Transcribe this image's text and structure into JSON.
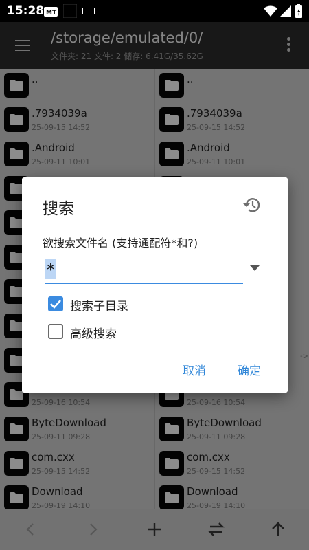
{
  "status_bar": {
    "time": "15:28",
    "icons": [
      "mt-manager-icon",
      "black-square-icon",
      "keyboard-icon",
      "wifi-icon",
      "signal-icon",
      "battery-icon"
    ]
  },
  "app_bar": {
    "path": "/storage/emulated/0/",
    "stats": "文件夹: 21  文件: 2  储存: 6.41G/35.62G"
  },
  "left_pane": {
    "items": [
      {
        "name": "..",
        "date": ""
      },
      {
        "name": ".7934039a",
        "date": "25-09-15 14:52"
      },
      {
        "name": ".Android",
        "date": "25-09-11 10:01"
      },
      {
        "name": "",
        "date": ""
      },
      {
        "name": "",
        "date": ""
      },
      {
        "name": "",
        "date": ""
      },
      {
        "name": "",
        "date": ""
      },
      {
        "name": "",
        "date": ""
      },
      {
        "name": "",
        "date": ""
      },
      {
        "name": "",
        "date": "25-09-16 10:54"
      },
      {
        "name": "ByteDownload",
        "date": "25-09-11 09:28"
      },
      {
        "name": "com.cxx",
        "date": "25-09-15 14:52"
      },
      {
        "name": "Download",
        "date": "25-09-19 14:10"
      }
    ]
  },
  "right_pane": {
    "items": [
      {
        "name": "..",
        "date": ""
      },
      {
        "name": ".7934039a",
        "date": "25-09-15 14:52"
      },
      {
        "name": ".Android",
        "date": "25-09-11 10:01"
      },
      {
        "name": "",
        "date": ""
      },
      {
        "name": "",
        "date": ""
      },
      {
        "name": "",
        "date": ""
      },
      {
        "name": "",
        "date": ""
      },
      {
        "name": "",
        "date": ""
      },
      {
        "name": "",
        "date": ""
      },
      {
        "name": "",
        "date": "25-09-16 10:54"
      },
      {
        "name": "ByteDownload",
        "date": "25-09-11 09:28"
      },
      {
        "name": "com.cxx",
        "date": "25-09-15 14:52"
      },
      {
        "name": "Download",
        "date": "25-09-19 14:10"
      }
    ]
  },
  "pane_arrow_hint": "->",
  "dialog": {
    "title": "搜索",
    "label": "欲搜索文件名 (支持通配符*和?)",
    "search_value": "*",
    "search_subdir": {
      "label": "搜索子目录",
      "checked": true
    },
    "advanced": {
      "label": "高级搜索",
      "checked": false
    },
    "cancel": "取消",
    "confirm": "确定"
  },
  "bottom_bar": {
    "icons": [
      "back-arrow-icon",
      "forward-arrow-icon",
      "add-icon",
      "swap-icon",
      "up-arrow-icon"
    ]
  },
  "colors": {
    "accent": "#3b8be0",
    "app_bar": "#2c2c2c",
    "pane_bg": "#d3d3d3"
  }
}
